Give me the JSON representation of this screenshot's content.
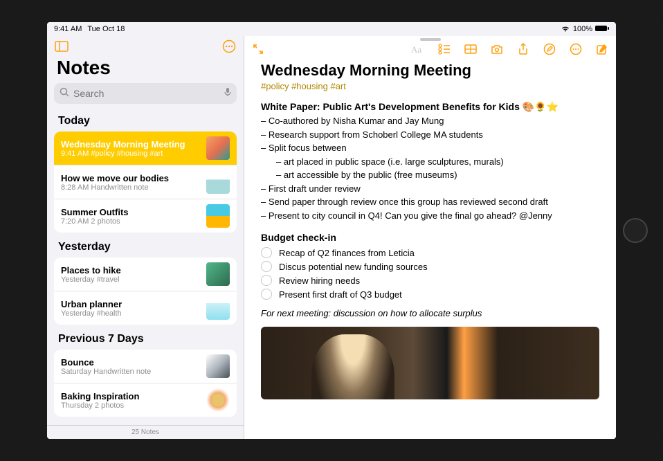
{
  "status": {
    "time": "9:41 AM",
    "date": "Tue Oct 18",
    "battery_pct": "100%"
  },
  "sidebar": {
    "title": "Notes",
    "search_placeholder": "Search",
    "footer": "25 Notes",
    "sections": [
      {
        "header": "Today",
        "items": [
          {
            "title": "Wednesday Morning Meeting",
            "sub": "9:41 AM  #policy #housing #art",
            "selected": true
          },
          {
            "title": "How we move our bodies",
            "sub": "8:28 AM  Handwritten note",
            "selected": false
          },
          {
            "title": "Summer Outfits",
            "sub": "7:20 AM  2 photos",
            "selected": false
          }
        ]
      },
      {
        "header": "Yesterday",
        "items": [
          {
            "title": "Places to hike",
            "sub": "Yesterday  #travel",
            "selected": false
          },
          {
            "title": "Urban planner",
            "sub": "Yesterday  #health",
            "selected": false
          }
        ]
      },
      {
        "header": "Previous 7 Days",
        "items": [
          {
            "title": "Bounce",
            "sub": "Saturday  Handwritten note",
            "selected": false
          },
          {
            "title": "Baking Inspiration",
            "sub": "Thursday  2 photos",
            "selected": false
          }
        ]
      }
    ]
  },
  "note": {
    "title": "Wednesday Morning Meeting",
    "tags": "#policy #housing #art",
    "section1_title": "White Paper: Public Art's Development Benefits for Kids 🎨🌻⭐",
    "lines": [
      "– Co-authored by Nisha Kumar and Jay Mung",
      "– Research support from Schoberl College MA students",
      "– Split focus between"
    ],
    "indented": [
      "– art placed in public space (i.e. large sculptures, murals)",
      "– art accessible by the public (free museums)"
    ],
    "lines2": [
      "– First draft under review",
      "– Send paper through review once this group has reviewed second draft",
      "– Present to city council in Q4! Can you give the final go ahead? @Jenny"
    ],
    "section2_title": "Budget check-in",
    "checklist": [
      "Recap of Q2 finances from Leticia",
      "Discus potential new funding sources",
      "Review hiring needs",
      "Present first draft of Q3 budget"
    ],
    "footer_italic": "For next meeting: discussion on how to allocate surplus"
  }
}
